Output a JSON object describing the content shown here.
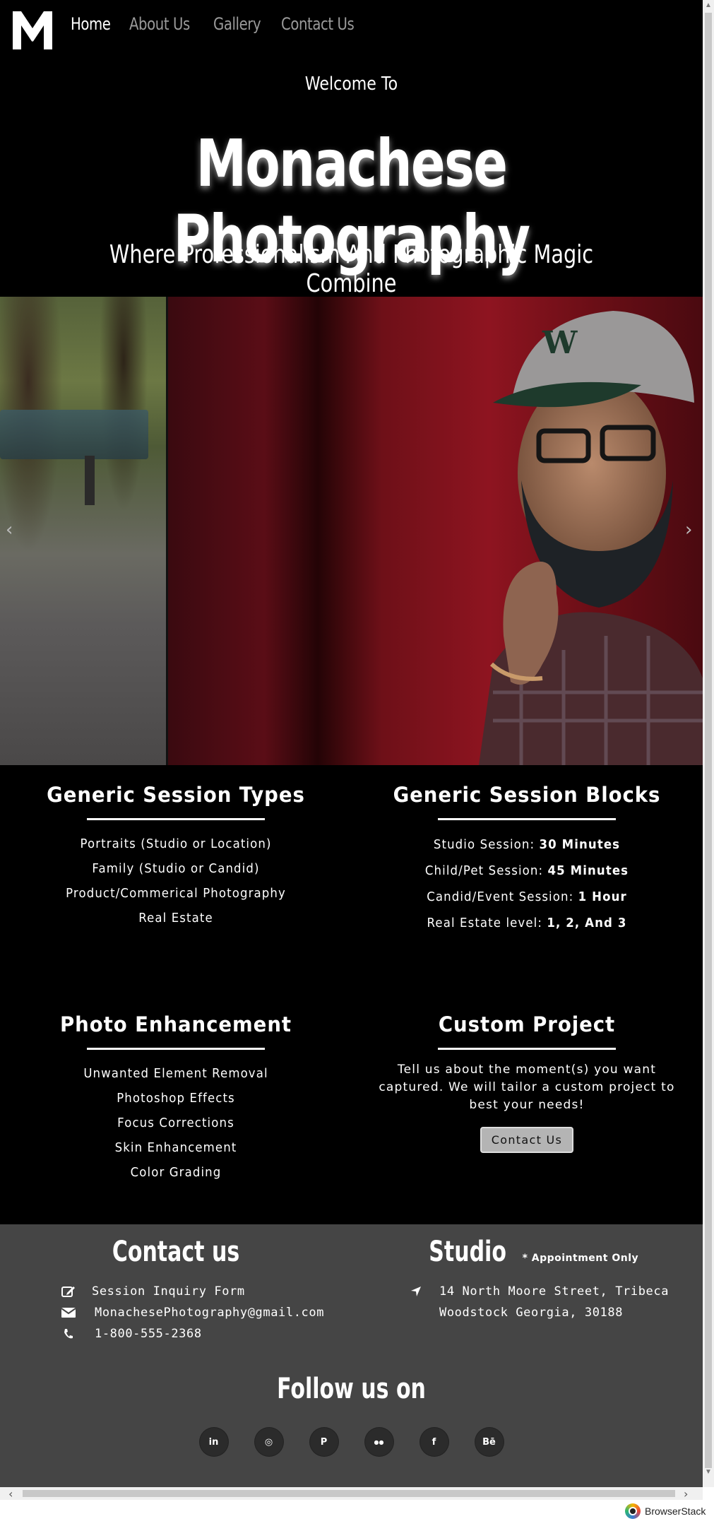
{
  "nav": {
    "logo_alt": "M",
    "links": [
      "Home",
      "About Us",
      "Gallery",
      "Contact Us"
    ],
    "active": "Home"
  },
  "hero": {
    "welcome": "Welcome To",
    "title": "Monachese Photography",
    "tagline": "Where Professionalism And Photographic Magic Combine"
  },
  "carousel": {
    "prev_icon": "chevron-left-icon",
    "next_icon": "chevron-right-icon",
    "prev_glyph": "‹",
    "next_glyph": "›"
  },
  "session_types": {
    "title": "Generic Session Types",
    "items": [
      "Portraits (Studio or Location)",
      "Family (Studio or Candid)",
      "Product/Commerical Photography",
      "Real Estate"
    ]
  },
  "session_blocks": {
    "title": "Generic Session Blocks",
    "items": [
      {
        "label": "Studio Session: ",
        "value": "30 Minutes"
      },
      {
        "label": "Child/Pet Session: ",
        "value": "45 Minutes"
      },
      {
        "label": "Candid/Event Session: ",
        "value": "1 Hour"
      },
      {
        "label": "Real Estate level: ",
        "value": "1, 2, And 3"
      }
    ]
  },
  "photo_enhancement": {
    "title": "Photo Enhancement",
    "items": [
      "Unwanted Element Removal",
      "Photoshop Effects",
      "Focus Corrections",
      "Skin Enhancement",
      "Color Grading"
    ]
  },
  "custom_project": {
    "title": "Custom Project",
    "text": "Tell us about the moment(s) you want captured. We will tailor a custom project to best your needs!",
    "button": "Contact Us"
  },
  "footer": {
    "contact_title": "Contact us",
    "contact_items": [
      {
        "icon": "edit-icon",
        "text": "Session Inquiry Form"
      },
      {
        "icon": "envelope-icon",
        "text": "MonachesePhotography@gmail.com"
      },
      {
        "icon": "phone-icon",
        "text": "1-800-555-2368"
      }
    ],
    "studio_title": "Studio",
    "studio_note": "* Appointment Only",
    "address_line1": "14 North Moore Street, Tribeca",
    "address_line2": "Woodstock Georgia, 30188",
    "follow_title": "Follow us on",
    "socials": [
      {
        "name": "linkedin-icon",
        "glyph": "in"
      },
      {
        "name": "instagram-icon",
        "glyph": "◎"
      },
      {
        "name": "pinterest-icon",
        "glyph": "P"
      },
      {
        "name": "flickr-icon",
        "glyph": "●●"
      },
      {
        "name": "facebook-icon",
        "glyph": "f"
      },
      {
        "name": "behance-icon",
        "glyph": "Bē"
      }
    ]
  },
  "browserstack": {
    "label": "BrowserStack"
  },
  "colors": {
    "background": "#000000",
    "footer": "#454545",
    "nav_inactive": "#9a9a9a",
    "button": "#b4b4b4"
  }
}
